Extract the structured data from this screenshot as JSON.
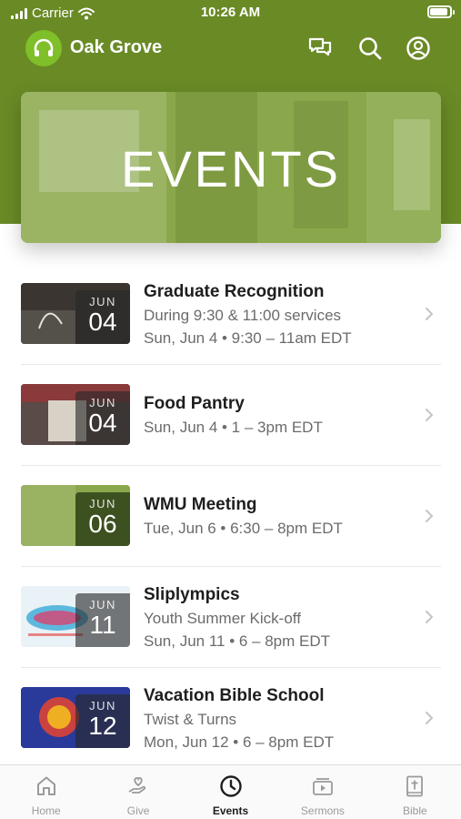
{
  "status_bar": {
    "carrier": "Carrier",
    "time": "10:26 AM"
  },
  "header": {
    "app_title": "Oak Grove"
  },
  "banner": {
    "title": "EVENTS"
  },
  "events": [
    {
      "title": "Graduate Recognition",
      "line1": "During 9:30 & 11:00 services",
      "line2": "Sun, Jun 4 • 9:30 – 11am EDT",
      "month": "JUN",
      "day": "04",
      "thumb_color": "#3a3530"
    },
    {
      "title": "Food Pantry",
      "line1": "Sun, Jun 4 • 1 – 3pm EDT",
      "line2": "",
      "month": "JUN",
      "day": "04",
      "thumb_color": "#5a4a48"
    },
    {
      "title": "WMU Meeting",
      "line1": "Tue, Jun 6 • 6:30 – 8pm EDT",
      "line2": "",
      "month": "JUN",
      "day": "06",
      "thumb_color": "#8aa84b"
    },
    {
      "title": "Sliplympics",
      "line1": "Youth Summer Kick-off",
      "line2": "Sun, Jun 11 • 6 – 8pm EDT",
      "month": "JUN",
      "day": "11",
      "thumb_color": "#e9f2f6"
    },
    {
      "title": "Vacation Bible School",
      "line1": "Twist & Turns",
      "line2": "Mon, Jun 12 • 6 – 8pm EDT",
      "month": "JUN",
      "day": "12",
      "thumb_color": "#2a3a9a"
    }
  ],
  "tabs": [
    {
      "label": "Home",
      "icon": "home-icon",
      "active": false
    },
    {
      "label": "Give",
      "icon": "give-hand-heart-icon",
      "active": false
    },
    {
      "label": "Events",
      "icon": "clock-icon",
      "active": true
    },
    {
      "label": "Sermons",
      "icon": "sermons-play-icon",
      "active": false
    },
    {
      "label": "Bible",
      "icon": "bible-cross-icon",
      "active": false
    }
  ],
  "colors": {
    "header_green": "#6a8a26",
    "logo_green": "#7fbf2a",
    "banner_green": "#8aa84b",
    "text_dark": "#1e1e1e",
    "text_muted": "#6b6b6b"
  }
}
